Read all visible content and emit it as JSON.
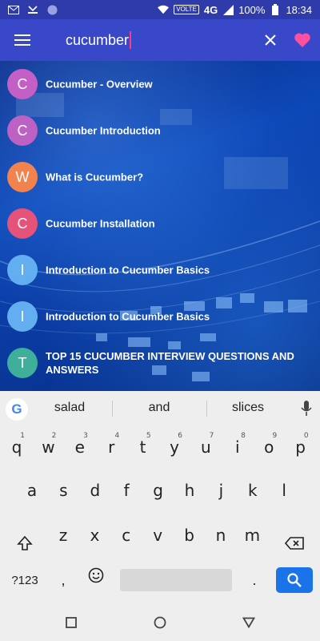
{
  "status_bar": {
    "volte": "VOLTE",
    "network": "4G",
    "battery": "100%",
    "time": "18:34"
  },
  "app_bar": {
    "search_value": "cucumber",
    "accent_color": "#3848c8"
  },
  "results": [
    {
      "letter": "C",
      "title": "Cucumber - Overview",
      "color": "#c35fc5"
    },
    {
      "letter": "C",
      "title": "Cucumber Introduction",
      "color": "#bd62c4"
    },
    {
      "letter": "W",
      "title": "What is Cucumber?",
      "color": "#f2834f"
    },
    {
      "letter": "C",
      "title": "Cucumber Installation",
      "color": "#e5527a"
    },
    {
      "letter": "I",
      "title": "Introduction to Cucumber Basics",
      "color": "#62aef0"
    },
    {
      "letter": "I",
      "title": "Introduction to Cucumber Basics",
      "color": "#62aef0"
    },
    {
      "letter": "T",
      "title": "TOP 15 CUCUMBER INTERVIEW QUESTIONS AND ANSWERS",
      "color": "#3fae9a"
    }
  ],
  "keyboard": {
    "suggestions": [
      "salad",
      "and",
      "slices"
    ],
    "row1": [
      {
        "k": "q",
        "n": "1"
      },
      {
        "k": "w",
        "n": "2"
      },
      {
        "k": "e",
        "n": "3"
      },
      {
        "k": "r",
        "n": "4"
      },
      {
        "k": "t",
        "n": "5"
      },
      {
        "k": "y",
        "n": "6"
      },
      {
        "k": "u",
        "n": "7"
      },
      {
        "k": "i",
        "n": "8"
      },
      {
        "k": "o",
        "n": "9"
      },
      {
        "k": "p",
        "n": "0"
      }
    ],
    "row2": [
      "a",
      "s",
      "d",
      "f",
      "g",
      "h",
      "j",
      "k",
      "l"
    ],
    "row3": [
      "z",
      "x",
      "c",
      "v",
      "b",
      "n",
      "m"
    ],
    "symbols_label": "?123",
    "comma": ",",
    "period": "."
  }
}
